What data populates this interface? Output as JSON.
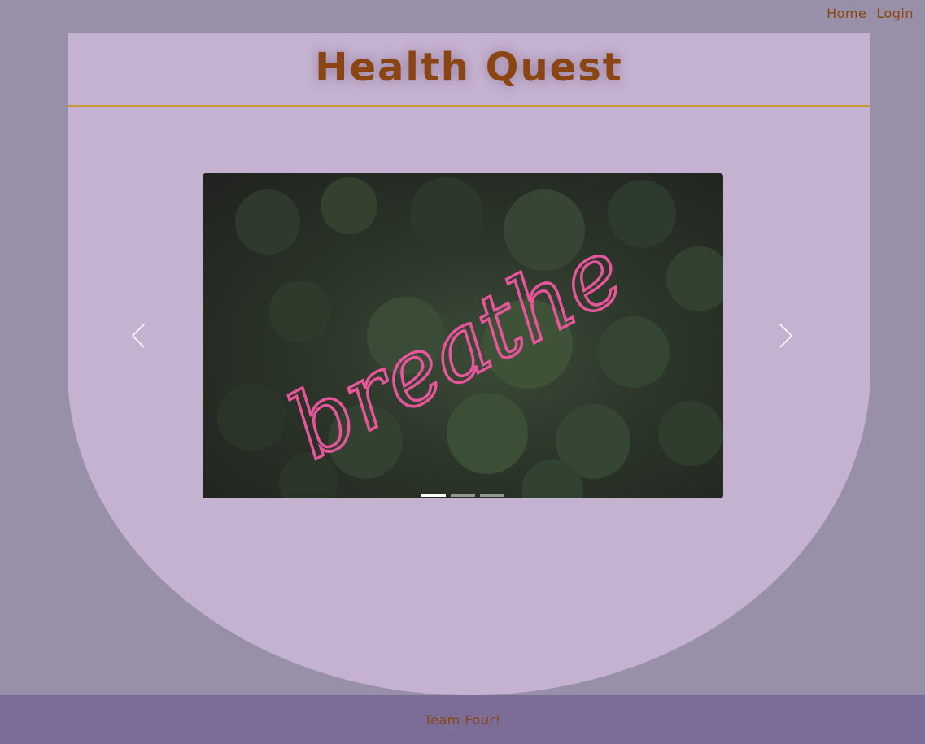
{
  "nav": {
    "home_label": "Home",
    "login_label": "Login"
  },
  "header": {
    "title": "Health Quest"
  },
  "carousel": {
    "slide_text": "breathe",
    "slide_count": 3,
    "active_index": 0
  },
  "footer": {
    "text": "Team Four!"
  },
  "colors": {
    "page_background": "#988fa9",
    "panel_background": "#c4b2d0",
    "accent_line": "#c99a38",
    "brand_text": "#8b4513",
    "footer_background": "#7b6d98",
    "neon_pink": "#e8559a"
  }
}
